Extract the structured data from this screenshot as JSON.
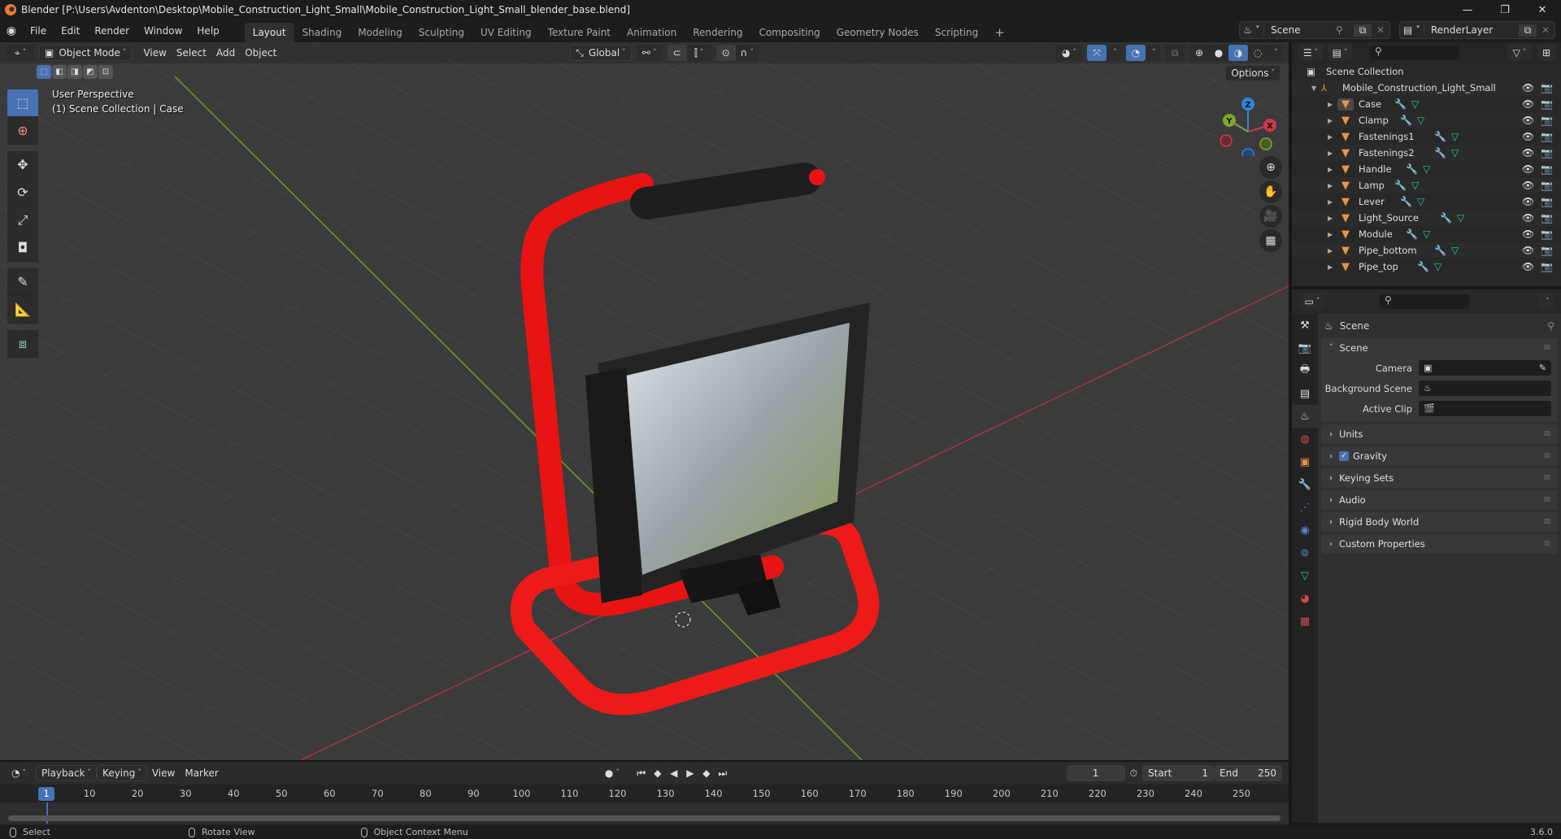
{
  "window": {
    "title": "Blender [P:\\Users\\Avdenton\\Desktop\\Mobile_Construction_Light_Small\\Mobile_Construction_Light_Small_blender_base.blend]",
    "controls": [
      "—",
      "❐",
      "✕"
    ]
  },
  "menu": [
    "File",
    "Edit",
    "Render",
    "Window",
    "Help"
  ],
  "workspace_tabs": [
    {
      "label": "Layout",
      "active": true
    },
    {
      "label": "Shading"
    },
    {
      "label": "Modeling"
    },
    {
      "label": "Sculpting"
    },
    {
      "label": "UV Editing"
    },
    {
      "label": "Texture Paint"
    },
    {
      "label": "Animation"
    },
    {
      "label": "Rendering"
    },
    {
      "label": "Compositing"
    },
    {
      "label": "Geometry Nodes"
    },
    {
      "label": "Scripting"
    }
  ],
  "add_workspace": "+",
  "scene_selector": {
    "value": "Scene"
  },
  "view_layer_selector": {
    "value": "RenderLayer"
  },
  "viewport": {
    "mode": "Object Mode",
    "menus": [
      "View",
      "Select",
      "Add",
      "Object"
    ],
    "transform_orientation": "Global",
    "options_label": "Options",
    "overlay_line1": "User Perspective",
    "overlay_line2": "(1) Scene Collection | Case",
    "gizmo_axes": {
      "x": "X",
      "y": "Y",
      "z": "Z"
    },
    "colors": {
      "x_axis": "#d0384a",
      "y_axis": "#7ea82d",
      "z_axis": "#2f85e0",
      "accent": "#4772b3",
      "stand": "#ee1515"
    }
  },
  "tools": [
    "select-box",
    "cursor",
    "move",
    "rotate",
    "scale",
    "transform",
    "annotate",
    "measure",
    "add-cube"
  ],
  "outliner": {
    "root": "Scene Collection",
    "collection": "Mobile_Construction_Light_Small",
    "objects": [
      "Case",
      "Clamp",
      "Fastenings1",
      "Fastenings2",
      "Handle",
      "Lamp",
      "Lever",
      "Light_Source",
      "Module",
      "Pipe_bottom",
      "Pipe_top"
    ]
  },
  "properties": {
    "context_title": "Scene",
    "scene_panel": {
      "title": "Scene",
      "fields": [
        {
          "label": "Camera",
          "value": ""
        },
        {
          "label": "Background Scene",
          "value": ""
        },
        {
          "label": "Active Clip",
          "value": ""
        }
      ]
    },
    "collapsed_panels": [
      {
        "title": "Units"
      },
      {
        "title": "Gravity",
        "checkbox": true
      },
      {
        "title": "Keying Sets"
      },
      {
        "title": "Audio"
      },
      {
        "title": "Rigid Body World"
      },
      {
        "title": "Custom Properties"
      }
    ]
  },
  "timeline": {
    "menus": [
      "Playback",
      "Keying",
      "View",
      "Marker"
    ],
    "current_frame": "1",
    "start_label": "Start",
    "start": "1",
    "end_label": "End",
    "end": "250",
    "ticks": [
      "10",
      "20",
      "30",
      "40",
      "50",
      "60",
      "70",
      "80",
      "90",
      "100",
      "110",
      "120",
      "130",
      "140",
      "150",
      "160",
      "170",
      "180",
      "190",
      "200",
      "210",
      "220",
      "230",
      "240",
      "250"
    ],
    "playhead_label": "1"
  },
  "statusbar": {
    "items": [
      "Select",
      "Rotate View",
      "Object Context Menu"
    ],
    "version": "3.6.0"
  }
}
